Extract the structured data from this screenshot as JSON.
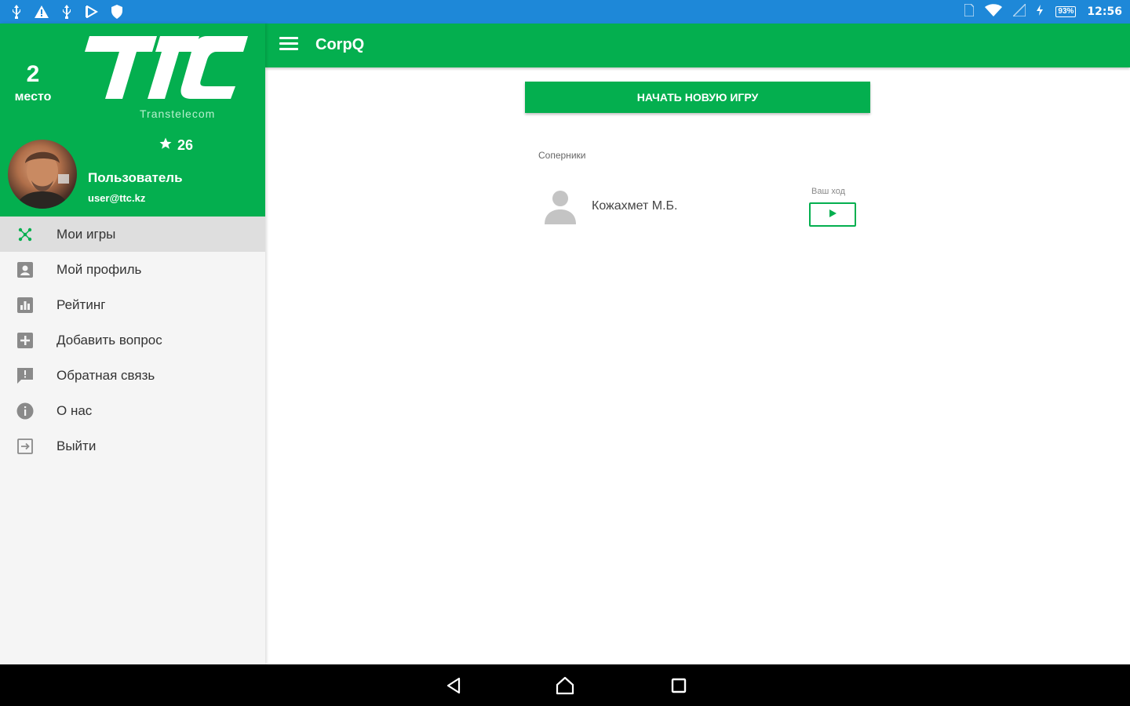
{
  "status_bar": {
    "time": "12:56",
    "battery_percent": "93%",
    "left_icons": [
      "usb-icon",
      "warning-icon",
      "usb-icon",
      "media-icon",
      "shield-icon"
    ],
    "right_icons": [
      "sim-icon",
      "wifi-icon",
      "signal-icon",
      "charging-icon",
      "battery-icon"
    ]
  },
  "drawer": {
    "rank_number": "2",
    "rank_label": "место",
    "logo_subtitle": "Transtelecom",
    "score": "26",
    "user_name": "Пользователь",
    "user_email": "user@ttc.kz",
    "menu": [
      {
        "label": "Мои игры",
        "icon": "games-icon",
        "active": true
      },
      {
        "label": "Мой профиль",
        "icon": "profile-icon",
        "active": false
      },
      {
        "label": "Рейтинг",
        "icon": "rating-icon",
        "active": false
      },
      {
        "label": "Добавить вопрос",
        "icon": "add-question-icon",
        "active": false
      },
      {
        "label": "Обратная связь",
        "icon": "feedback-icon",
        "active": false
      },
      {
        "label": "О нас",
        "icon": "info-icon",
        "active": false
      },
      {
        "label": "Выйти",
        "icon": "logout-icon",
        "active": false
      }
    ]
  },
  "appbar": {
    "title": "CorpQ"
  },
  "main": {
    "new_game_button": "НАЧАТЬ НОВУЮ ИГРУ",
    "section_label": "Соперники",
    "opponents": [
      {
        "name": "Кожахмет М.Б.",
        "status": "Ваш ход"
      }
    ]
  },
  "colors": {
    "primary": "#04af4f",
    "status_bar": "#1e88d8",
    "drawer_bg": "#f5f5f5",
    "active_item_bg": "#dedede"
  }
}
